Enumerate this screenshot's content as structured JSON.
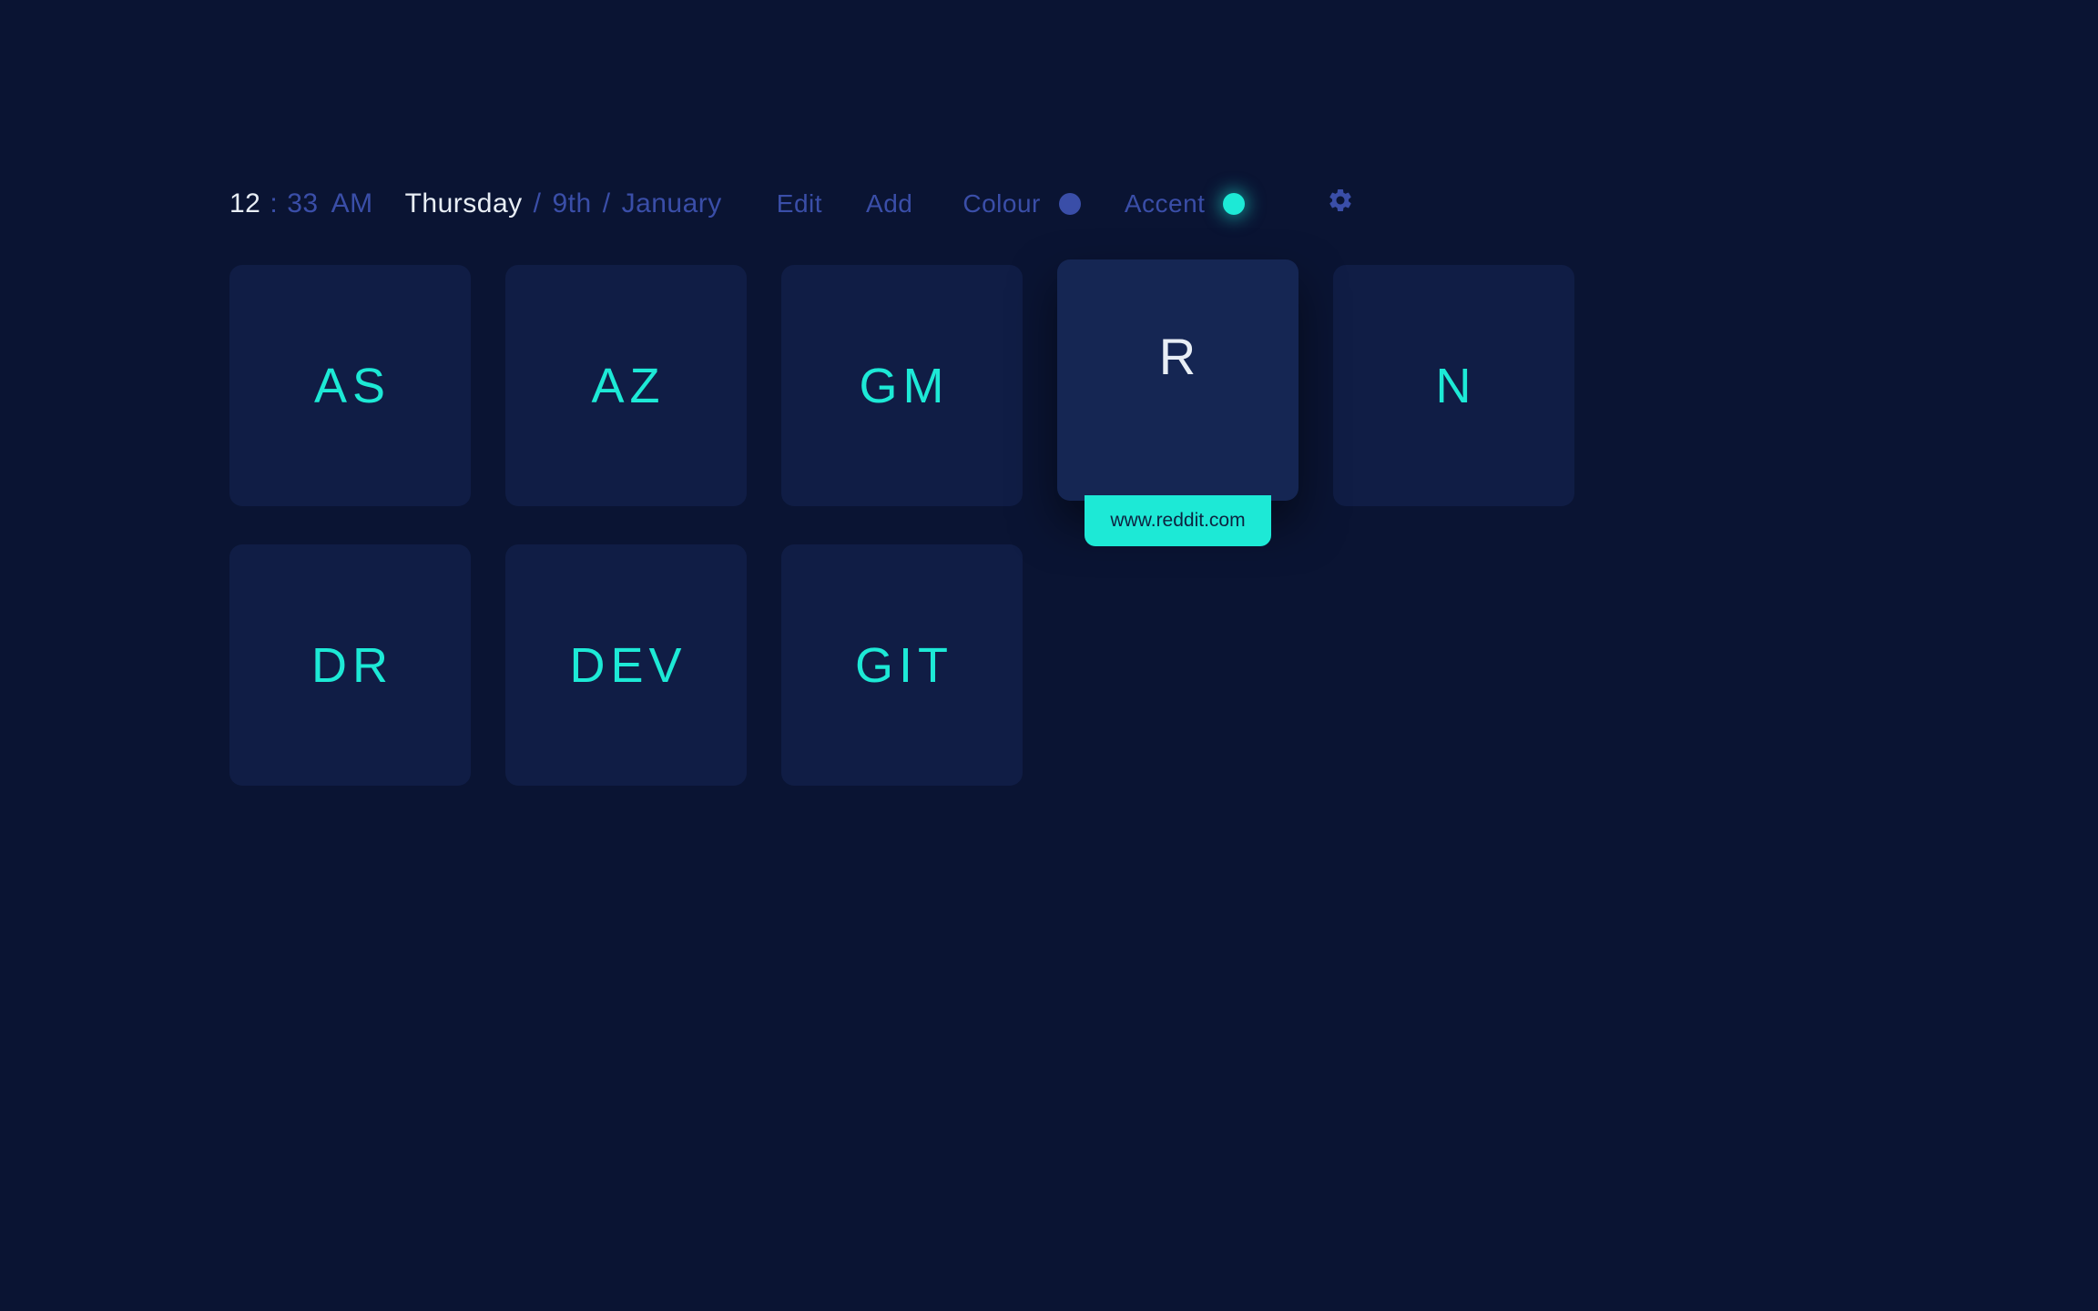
{
  "clock": {
    "hour": "12",
    "separator": ":",
    "minute": "33",
    "ampm": "AM"
  },
  "date": {
    "day": "Thursday",
    "separator": "/",
    "num": "9th",
    "month": "January"
  },
  "actions": {
    "edit": "Edit",
    "add": "Add"
  },
  "color": {
    "colour_label": "Colour",
    "accent_label": "Accent",
    "colour_hex": "#3a4ea8",
    "accent_hex": "#1de9d6"
  },
  "tiles": [
    {
      "label": "AS",
      "active": false
    },
    {
      "label": "AZ",
      "active": false
    },
    {
      "label": "GM",
      "active": false
    },
    {
      "label": "R",
      "active": true,
      "url": "www.reddit.com"
    },
    {
      "label": "N",
      "active": false
    },
    {
      "label": "DR",
      "active": false
    },
    {
      "label": "DEV",
      "active": false
    },
    {
      "label": "GIT",
      "active": false
    }
  ]
}
